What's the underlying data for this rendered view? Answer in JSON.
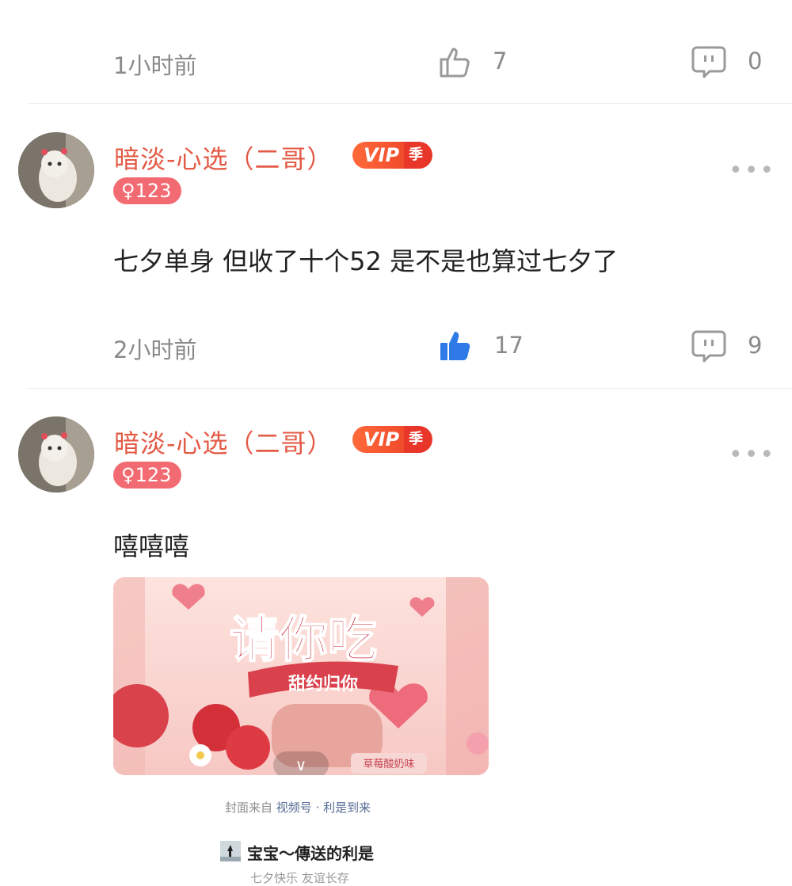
{
  "comment0": {
    "time": "1小时前",
    "likes": "7",
    "replies": "0",
    "liked": false
  },
  "comment1": {
    "username": "暗淡-心选（二哥）",
    "vip_label": "VIP",
    "vip_suffix": "季",
    "gender_badge": "♀123",
    "text": "七夕单身 但收了十个52 是不是也算过七夕了",
    "time": "2小时前",
    "likes": "17",
    "replies": "9",
    "liked": true,
    "more": "•••"
  },
  "comment2": {
    "username": "暗淡-心选（二哥）",
    "vip_label": "VIP",
    "vip_suffix": "季",
    "gender_badge": "♀123",
    "text": "嘻嘻嘻",
    "more": "•••",
    "attachment": {
      "cover_title": "请你吃",
      "cover_ribbon": "甜约归你",
      "cover_flavor": "草莓酸奶味",
      "expand_icon": "∨",
      "source_prefix": "封面来自",
      "source_name": "视频号 · 利是到来",
      "forward_title": "宝宝～傳送的利是",
      "forward_subtitle": "七夕快乐 友谊长存"
    }
  },
  "colors": {
    "accent_name": "#e35a45",
    "like_active": "#2e7be8",
    "icon_gray": "#9a9a9a"
  }
}
